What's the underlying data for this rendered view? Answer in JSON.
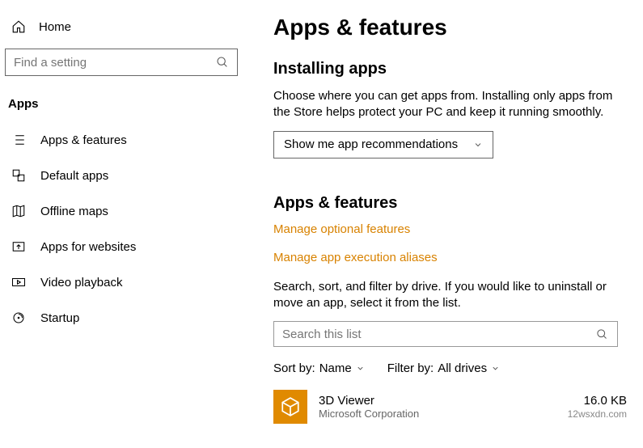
{
  "sidebar": {
    "home_label": "Home",
    "search_placeholder": "Find a setting",
    "category": "Apps",
    "items": [
      {
        "label": "Apps & features"
      },
      {
        "label": "Default apps"
      },
      {
        "label": "Offline maps"
      },
      {
        "label": "Apps for websites"
      },
      {
        "label": "Video playback"
      },
      {
        "label": "Startup"
      }
    ]
  },
  "main": {
    "title": "Apps & features",
    "installing_heading": "Installing apps",
    "installing_desc": "Choose where you can get apps from. Installing only apps from the Store helps protect your PC and keep it running smoothly.",
    "dropdown_value": "Show me app recommendations",
    "af_heading": "Apps & features",
    "link1": "Manage optional features",
    "link2": "Manage app execution aliases",
    "af_desc": "Search, sort, and filter by drive. If you would like to uninstall or move an app, select it from the list.",
    "list_search_placeholder": "Search this list",
    "sort_label": "Sort by:",
    "sort_value": "Name",
    "filter_label": "Filter by:",
    "filter_value": "All drives",
    "app": {
      "name": "3D Viewer",
      "publisher": "Microsoft Corporation",
      "size": "16.0 KB",
      "date": "12wsxdn.com"
    }
  }
}
